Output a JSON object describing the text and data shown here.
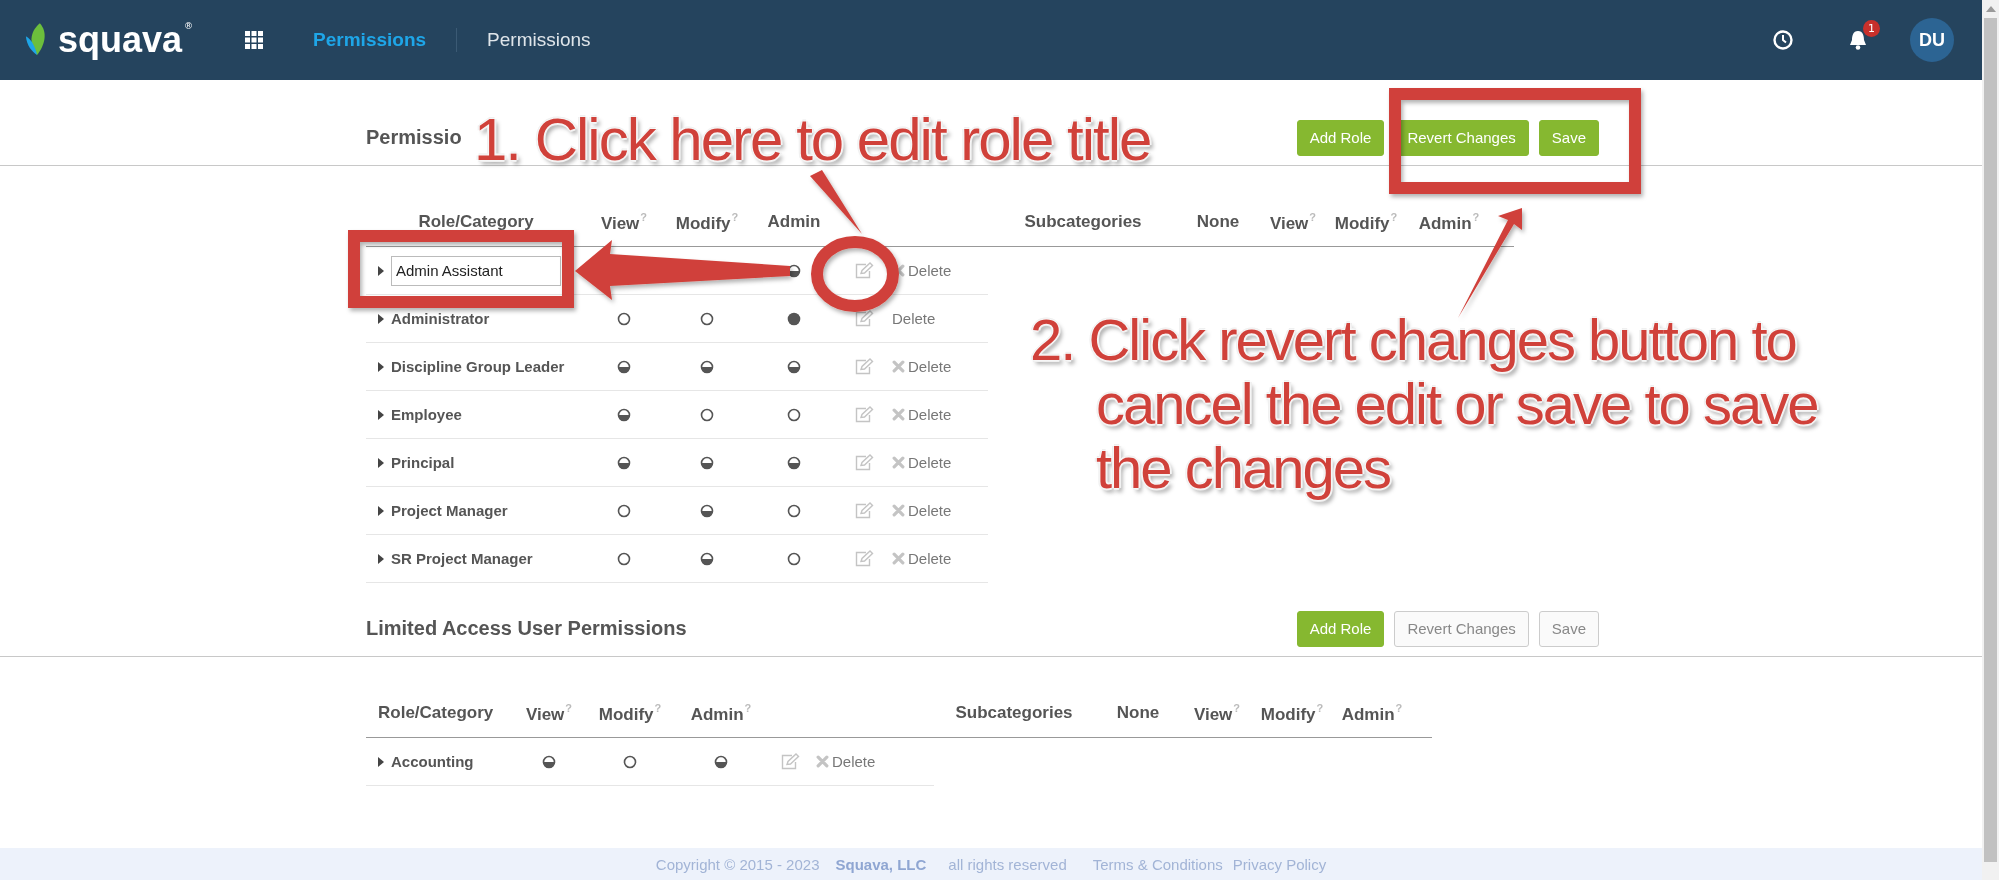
{
  "header": {
    "brand": "squava",
    "brand_mark": "®",
    "nav": [
      {
        "label": "Permissions",
        "selected": true
      },
      {
        "label": "Permissions",
        "selected": false
      }
    ],
    "notifications": "1",
    "avatar": "DU"
  },
  "sections": [
    {
      "title": "Permissio",
      "buttons": [
        {
          "label": "Add Role",
          "disabled": false
        },
        {
          "label": "Revert Changes",
          "disabled": false
        },
        {
          "label": "Save",
          "disabled": false
        }
      ],
      "columns": [
        {
          "label": "Role/Category"
        },
        {
          "label": "View",
          "hint": "?"
        },
        {
          "label": "Modify",
          "hint": "?"
        },
        {
          "label": "Admin"
        }
      ],
      "sub_columns": [
        {
          "label": "Subcategories"
        },
        {
          "label": "None"
        },
        {
          "label": "View",
          "hint": "?"
        },
        {
          "label": "Modify",
          "hint": "?"
        },
        {
          "label": "Admin",
          "hint": "?"
        }
      ],
      "rows": [
        {
          "name": "Admin Assistant",
          "editing": true,
          "admin": {
            "kind": "half"
          },
          "delete": "Delete",
          "deletable": true
        },
        {
          "name": "Administrator",
          "editing": false,
          "view": {
            "kind": "empty"
          },
          "modify": {
            "kind": "empty"
          },
          "admin": {
            "kind": "full"
          },
          "delete": "Delete",
          "deletable": false
        },
        {
          "name": "Discipline Group Leader",
          "editing": false,
          "view": {
            "kind": "half"
          },
          "modify": {
            "kind": "half"
          },
          "admin": {
            "kind": "half"
          },
          "delete": "Delete",
          "deletable": true
        },
        {
          "name": "Employee",
          "editing": false,
          "view": {
            "kind": "half"
          },
          "modify": {
            "kind": "empty"
          },
          "admin": {
            "kind": "empty"
          },
          "delete": "Delete",
          "deletable": true
        },
        {
          "name": "Principal",
          "editing": false,
          "view": {
            "kind": "half"
          },
          "modify": {
            "kind": "half"
          },
          "admin": {
            "kind": "half"
          },
          "delete": "Delete",
          "deletable": true
        },
        {
          "name": "Project Manager",
          "editing": false,
          "view": {
            "kind": "empty"
          },
          "modify": {
            "kind": "half"
          },
          "admin": {
            "kind": "empty"
          },
          "delete": "Delete",
          "deletable": true
        },
        {
          "name": "SR Project Manager",
          "editing": false,
          "view": {
            "kind": "empty"
          },
          "modify": {
            "kind": "half"
          },
          "admin": {
            "kind": "empty"
          },
          "delete": "Delete",
          "deletable": true
        }
      ]
    },
    {
      "title": "Limited Access User Permissions",
      "buttons": [
        {
          "label": "Add Role",
          "disabled": false
        },
        {
          "label": "Revert Changes",
          "disabled": true
        },
        {
          "label": "Save",
          "disabled": true
        }
      ],
      "columns": [
        {
          "label": "Role/Category"
        },
        {
          "label": "View",
          "hint": "?"
        },
        {
          "label": "Modify",
          "hint": "?"
        },
        {
          "label": "Admin",
          "hint": "?"
        }
      ],
      "sub_columns": [
        {
          "label": "Subcategories"
        },
        {
          "label": "None"
        },
        {
          "label": "View",
          "hint": "?"
        },
        {
          "label": "Modify",
          "hint": "?"
        },
        {
          "label": "Admin",
          "hint": "?"
        }
      ],
      "rows": [
        {
          "name": "Accounting",
          "editing": false,
          "view": {
            "kind": "half"
          },
          "modify": {
            "kind": "empty"
          },
          "admin": {
            "kind": "half"
          },
          "delete": "Delete",
          "deletable": true
        }
      ]
    }
  ],
  "footer": [
    {
      "text": "Copyright © 2015 - 2023",
      "kind": "text"
    },
    {
      "text": "Squava, LLC",
      "kind": "brand"
    },
    {
      "text": "all rights reserved",
      "kind": "text"
    },
    {
      "text": "Terms & Conditions",
      "kind": "link"
    },
    {
      "text": "Privacy Policy",
      "kind": "link"
    }
  ],
  "annotations": [
    {
      "kind": "callout",
      "text": "1. Click here to edit role title"
    },
    {
      "kind": "callout",
      "text": "2. Click revert changes button to cancel the edit or save to save the changes"
    }
  ]
}
